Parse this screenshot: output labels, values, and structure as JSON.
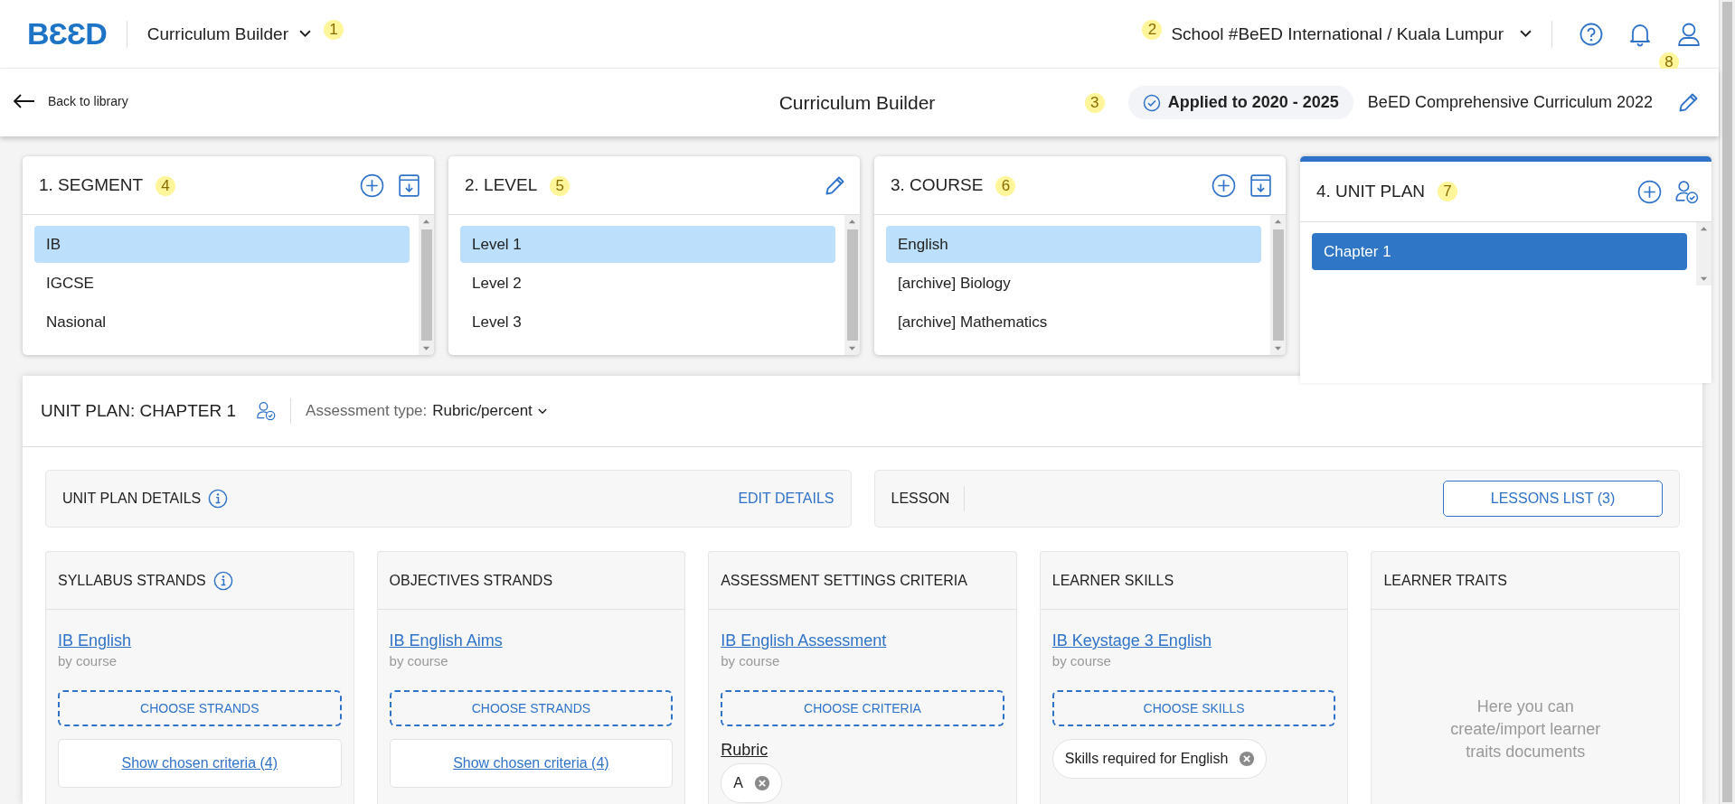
{
  "header": {
    "logo": "BƐƐD",
    "app_switcher": {
      "label": "Curriculum Builder",
      "marker": "1"
    },
    "school": {
      "label": "School #BeED International / Kuala Lumpur",
      "marker": "2"
    },
    "user_marker": "8"
  },
  "subheader": {
    "back": "Back to library",
    "title": "Curriculum Builder",
    "marker": "3",
    "applied": "Applied to 2020 - 2025",
    "curriculum": "BeED Comprehensive Curriculum 2022"
  },
  "panels": [
    {
      "title": "1. SEGMENT",
      "marker": "4",
      "active": false,
      "actions": [
        {
          "kind": "add"
        },
        {
          "kind": "archive"
        }
      ],
      "items": [
        {
          "label": "IB",
          "selected": true
        },
        {
          "label": "IGCSE",
          "selected": false
        },
        {
          "label": "Nasional",
          "selected": false
        }
      ]
    },
    {
      "title": "2. LEVEL",
      "marker": "5",
      "active": false,
      "actions": [
        {
          "kind": "edit"
        }
      ],
      "items": [
        {
          "label": "Level 1",
          "selected": true
        },
        {
          "label": "Level 2",
          "selected": false
        },
        {
          "label": "Level 3",
          "selected": false
        }
      ]
    },
    {
      "title": "3. COURSE",
      "marker": "6",
      "active": false,
      "actions": [
        {
          "kind": "add"
        },
        {
          "kind": "archive"
        }
      ],
      "items": [
        {
          "label": "English",
          "selected": true
        },
        {
          "label": "[archive] Biology",
          "selected": false
        },
        {
          "label": "[archive] Mathematics",
          "selected": false
        }
      ]
    },
    {
      "title": "4. UNIT PLAN",
      "marker": "7",
      "active": true,
      "actions": [
        {
          "kind": "add"
        },
        {
          "kind": "assign"
        }
      ],
      "items": [
        {
          "label": "Chapter 1",
          "selected": true
        }
      ]
    }
  ],
  "unit_plan": {
    "title": "UNIT PLAN: CHAPTER 1",
    "assessment_label": "Assessment type:",
    "assessment_value": "Rubric/percent",
    "details": {
      "title": "UNIT PLAN DETAILS",
      "action": "EDIT DETAILS"
    },
    "lesson": {
      "title": "LESSON",
      "action": "LESSONS LIST (3)"
    },
    "columns": [
      {
        "kind": "document",
        "title": "SYLLABUS STRANDS",
        "info": true,
        "link": "IB English",
        "sub": "by course",
        "button": "CHOOSE STRANDS",
        "show_link": "Show chosen criteria (4)"
      },
      {
        "kind": "document",
        "title": "OBJECTIVES STRANDS",
        "info": false,
        "link": "IB English Aims",
        "sub": "by course",
        "button": "CHOOSE STRANDS",
        "show_link": "Show chosen criteria (4)"
      },
      {
        "kind": "document",
        "title": "ASSESSMENT SETTINGS CRITERIA",
        "info": false,
        "link": "IB English Assessment",
        "sub": "by course",
        "button": "CHOOSE CRITERIA",
        "group": "Rubric",
        "chips": [
          "A"
        ]
      },
      {
        "kind": "document",
        "title": "LEARNER SKILLS",
        "info": false,
        "link": "IB Keystage 3 English",
        "sub": "by course",
        "button": "CHOOSE SKILLS",
        "chips": [
          "Skills required for English"
        ]
      },
      {
        "kind": "empty",
        "title": "LEARNER TRAITS",
        "info": false,
        "message": "Here you can create/import learner traits documents"
      }
    ]
  }
}
